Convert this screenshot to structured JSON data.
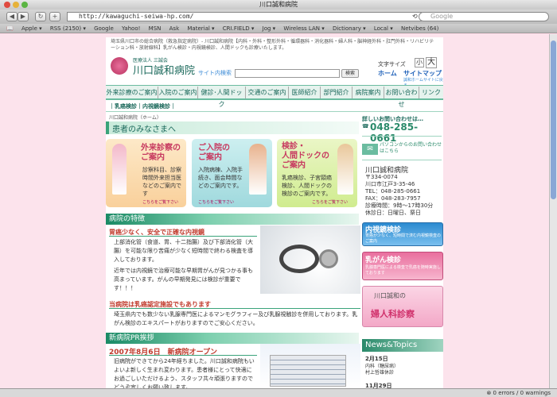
{
  "browser": {
    "title": "川口誠和病院",
    "url": "http://kawaguchi-seiwa-hp.com/",
    "search_placeholder": "Google",
    "bookmarks": [
      "Apple ▾",
      "RSS (2150) ▾",
      "Google",
      "Yahoo!",
      "MSN",
      "Ask",
      "Material ▾",
      "CRI.FIELD ▾",
      "Jog ▾",
      "Wireless LAN ▾",
      "Dictionary ▾",
      "Local ▾",
      "Netvibes (64)"
    ],
    "status": "⊗ 0 errors / 0 warnings"
  },
  "header": {
    "tagline": "埼玉県川口市の総合病院（救急指定病院）- 川口誠和病院【内科・外科・整形外科・循環器科・消化器科・婦人科・脳神経外科・肛門外科・リハビリテーション科・放射線科】乳がん検診・内視鏡検診、人間ドックも診療いたします。",
    "corp": "医療法人 三誠会",
    "name": "川口誠和病院",
    "site_search_label": "サイト内検索",
    "search_button": "検索",
    "text_size_label": "文字サイズ",
    "size_small": "小",
    "size_large": "大",
    "home": "ホーム",
    "sitemap": "サイトマップ",
    "site_note": "誠和ホームサイトに戻る"
  },
  "nav": [
    "外来診療のご案内",
    "入院のご案内",
    "健診･人間ドック",
    "交通のご案内",
    "医師紹介",
    "部門紹介",
    "病院案内",
    "お問い合わせ",
    "リンク"
  ],
  "subnav": "｜乳癌検診｜内視鏡検診｜",
  "breadcrumb": "川口誠和病院（ホーム）",
  "greeting": "患者のみなさまへ",
  "cards": [
    {
      "title": "外来診察の\nご案内",
      "body": "診察科目、診察時間外来担当医などのご案内です",
      "more": "こちらをご覧下さい"
    },
    {
      "title": "ご入院の\nご案内",
      "body": "入院病棟、入院手続き、面会時間などのご案内です。",
      "more": "こちらをご覧下さい"
    },
    {
      "title": "検診・\n人間ドックの\nご案内",
      "body": "乳癌検診、子宮頸癌検診、人間ドックの検診のご案内です。",
      "more": "こちらをご覧下さい"
    }
  ],
  "features": {
    "heading": "病院の特徴",
    "sub1": "胃癌少なく、安全で正確な内視鏡",
    "p1": "上部消化管（食道、胃、十二指腸）及び下部消化管（大腸）を可能な限り苦痛が少なく短時間で終わる検査を導入しております。",
    "p2": "近年では内視鏡で治療可能な早期胃がんが見つかる事も高まっています。がんの早期発見には検診が重要です！！！",
    "sub2": "当病院は乳癌認定施設でもあります",
    "p3": "埼玉県内でも数少ない乳腺専門医によるマンモグラフィー及び乳腺視触診を併用しております。乳がん検診のエキスパートがおりますのでご安心ください。"
  },
  "pr": {
    "heading": "新病院PR挨拶",
    "sub": "2007年8月6日　新病院オープン",
    "p": "旧病院ができてから24年経ちました。川口誠和病院もいよいよ新しく生まれ変わります。患者様にとって快適にお過ごしいただけるよう、スタッフ共々頑張りますのでどうぞ宜しくお願い致します。"
  },
  "sidebar": {
    "contact_label": "詳しいお問い合わせは…",
    "phone": "048-285-0661",
    "mail": "パソコンからのお問い合わせはこちら",
    "address_name": "川口誠和病院",
    "postal": "〒334-0074",
    "addr": "川口市江戸3-35-46",
    "tel": "TEL：048-285-0661",
    "fax": "FAX：048-283-7957",
    "hours": "診療時間：9時〜17時30分",
    "closed": "休診日：日曜日、祭日",
    "btn1_title": "内視鏡検診",
    "btn1_body": "胃癌が少なく、短時間で済む内視鏡検査のご案内",
    "btn2_title": "乳がん検診",
    "btn2_body": "乳腺専門医による検査で乳癌を随時実施しております",
    "btn3_a": "川口誠和の",
    "btn3_b": "婦人科診察",
    "news_title": "News&Topics",
    "news": [
      {
        "date": "2月15日",
        "text": "内科（糖尿病）\n村上哲雄休診"
      },
      {
        "date": "11月29日",
        "text": ""
      }
    ]
  }
}
